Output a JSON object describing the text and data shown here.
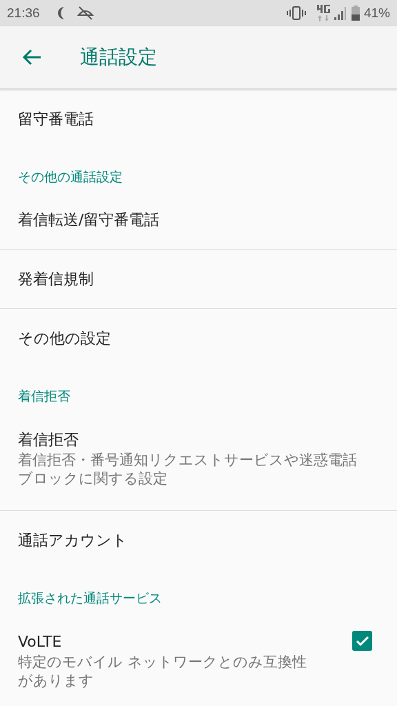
{
  "status_bar": {
    "time": "21:36",
    "battery": "41%"
  },
  "app_bar": {
    "title": "通話設定"
  },
  "sections": [
    {
      "items": [
        {
          "kind": "pref",
          "title": "留守番電話"
        }
      ]
    },
    {
      "header": "その他の通話設定",
      "items": [
        {
          "kind": "pref",
          "title": "着信転送/留守番電話"
        },
        {
          "kind": "pref",
          "title": "発着信規制"
        },
        {
          "kind": "pref",
          "title": "その他の設定"
        }
      ]
    },
    {
      "header": "着信拒否",
      "items": [
        {
          "kind": "pref",
          "title": "着信拒否",
          "summary": "着信拒否・番号通知リクエストサービスや迷惑電話ブロックに関する設定"
        },
        {
          "kind": "pref",
          "title": "通話アカウント"
        }
      ]
    },
    {
      "header": "拡張された通話サービス",
      "items": [
        {
          "kind": "checkbox",
          "title": "VoLTE",
          "summary": "特定のモバイル ネットワークとのみ互換性があります",
          "checked": true
        }
      ]
    }
  ]
}
